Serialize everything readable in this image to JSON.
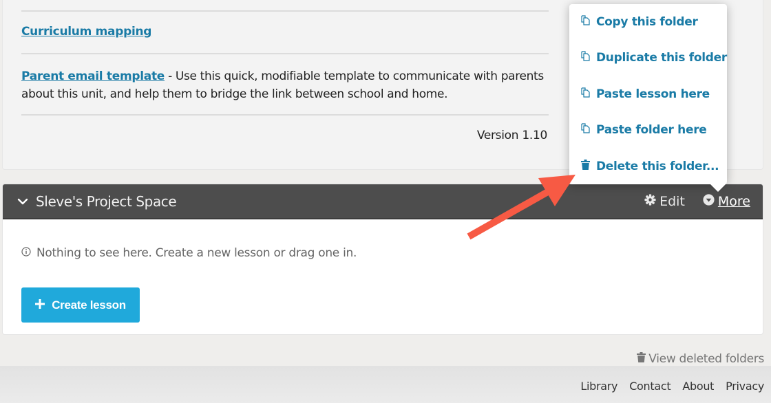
{
  "resources": {
    "curriculum_link": "Curriculum mapping",
    "parent_link": "Parent email template",
    "parent_description": " - Use this quick, modifiable template to communicate with parents about this unit, and help them to bridge the link between school and home.",
    "version": "Version 1.10"
  },
  "folder": {
    "title": "Sleve's Project Space",
    "edit_label": "Edit",
    "more_label": "More",
    "empty_message": "Nothing to see here. Create a new lesson or drag one in.",
    "create_button": "Create lesson"
  },
  "more_menu": {
    "items": [
      {
        "label": "Copy this folder",
        "icon": "copy-icon"
      },
      {
        "label": "Duplicate this folder",
        "icon": "copy-icon"
      },
      {
        "label": "Paste lesson here",
        "icon": "copy-icon"
      },
      {
        "label": "Paste folder here",
        "icon": "copy-icon"
      },
      {
        "label": "Delete this folder...",
        "icon": "trash-icon"
      }
    ]
  },
  "view_deleted": "View deleted folders",
  "footer": {
    "links": [
      "Library",
      "Contact",
      "About",
      "Privacy"
    ]
  },
  "colors": {
    "link": "#1a7ba6",
    "header_bg": "#4d4d4d",
    "primary_button": "#20a9db",
    "annotation_arrow": "#f75a44"
  }
}
